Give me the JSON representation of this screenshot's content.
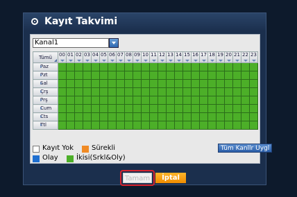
{
  "window": {
    "title": "Kayıt Takvimi"
  },
  "channel_select": {
    "value": "Kanal1"
  },
  "grid": {
    "corner_label": "Tümü",
    "hours": [
      "00",
      "01",
      "02",
      "03",
      "04",
      "05",
      "06",
      "07",
      "08",
      "09",
      "10",
      "11",
      "12",
      "13",
      "14",
      "15",
      "16",
      "17",
      "18",
      "19",
      "20",
      "21",
      "22",
      "23"
    ],
    "days": [
      "Paz",
      "Pzt",
      "Sal",
      "Çrş",
      "Prş",
      "Cum",
      "Cts",
      "Ttl"
    ],
    "cell_mode": "İkisi(Srkl&Oly)"
  },
  "legend": {
    "none_label": "Kayıt Yok",
    "continuous_label": "Sürekli",
    "event_label": "Olay",
    "both_label": "İkisi(Srkl&Oly)",
    "colors": {
      "none": "#ffffff",
      "continuous": "#f08a24",
      "event": "#1f6fd0",
      "both": "#4caf28"
    }
  },
  "apply_all_button": "Tüm Kanllr Uygl",
  "buttons": {
    "ok": "Tamam",
    "cancel": "İptal"
  },
  "colors": {
    "accent": "#f39a0a",
    "highlight": "#d9232e"
  }
}
